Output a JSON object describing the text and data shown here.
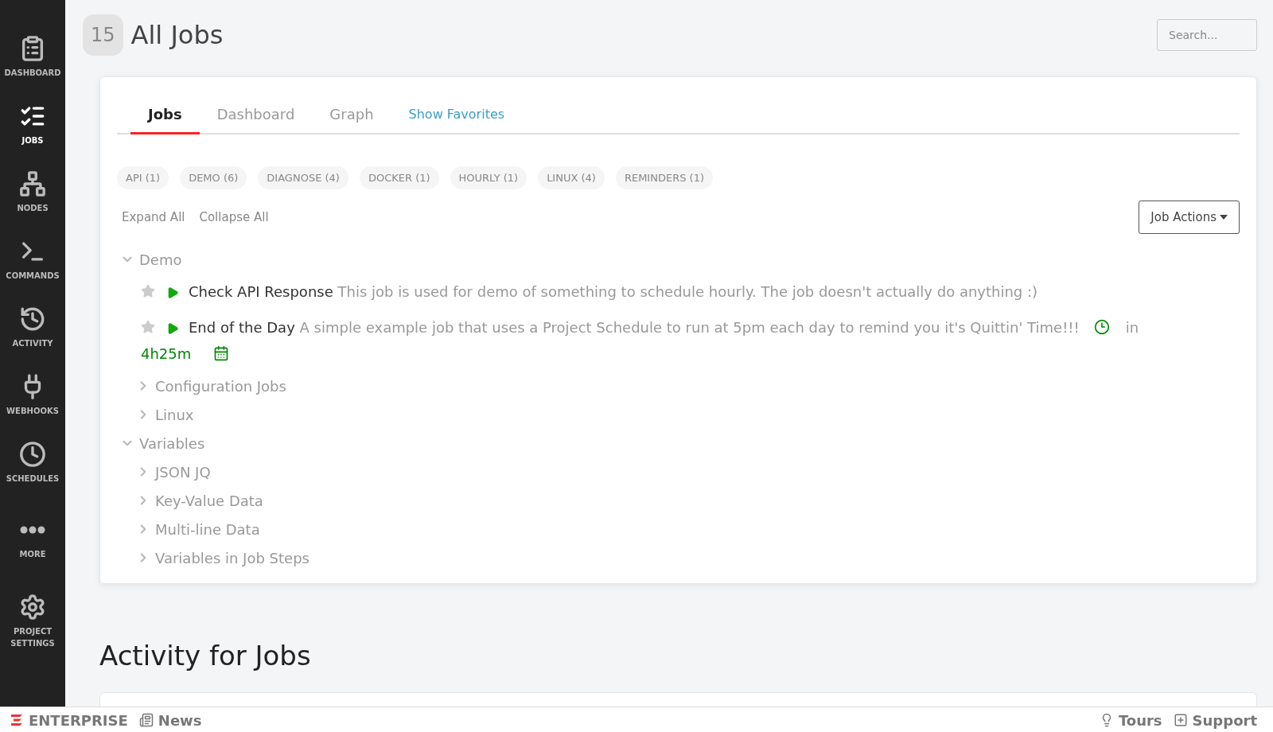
{
  "sidebar": {
    "items": [
      {
        "label": "DASHBOARD",
        "selected": false
      },
      {
        "label": "JOBS",
        "selected": true
      },
      {
        "label": "NODES",
        "selected": false
      },
      {
        "label": "COMMANDS",
        "selected": false
      },
      {
        "label": "ACTIVITY",
        "selected": false
      },
      {
        "label": "WEBHOOKS",
        "selected": false
      },
      {
        "label": "SCHEDULES",
        "selected": false
      },
      {
        "label": "MORE",
        "selected": false
      },
      {
        "label": "PROJECT SETTINGS",
        "selected": false
      }
    ]
  },
  "header": {
    "count": "15",
    "title": "All Jobs",
    "search": {
      "placeholder": "Search..."
    }
  },
  "tabs": [
    {
      "label": "Jobs",
      "selected": true,
      "kind": "tab"
    },
    {
      "label": "Dashboard",
      "selected": false,
      "kind": "tab"
    },
    {
      "label": "Graph",
      "selected": false,
      "kind": "tab"
    },
    {
      "label": "Show Favorites",
      "selected": false,
      "kind": "link"
    }
  ],
  "tags": [
    "API (1)",
    "DEMO (6)",
    "DIAGNOSE (4)",
    "DOCKER (1)",
    "HOURLY (1)",
    "LINUX (4)",
    "REMINDERS (1)"
  ],
  "tree_actions": [
    "Expand All",
    "Collapse All"
  ],
  "job_actions": {
    "label": "Job Actions"
  },
  "tree": [
    {
      "kind": "group",
      "label": "Demo",
      "expanded": true,
      "children": [
        {
          "kind": "job",
          "name": "Check API Response",
          "description": "This job is used for demo of something to schedule hourly. The job doesn't actually do anything :)",
          "favorite": false
        },
        {
          "kind": "job",
          "name": "End of the Day",
          "description": "A simple example job that uses a Project Schedule to run at 5pm each day to remind you it's Quittin' Time!!!",
          "favorite": false,
          "schedule": {
            "prefix": "in",
            "next": "4h25m"
          }
        },
        {
          "kind": "group",
          "label": "Configuration Jobs",
          "expanded": false
        },
        {
          "kind": "group",
          "label": "Linux",
          "expanded": false
        }
      ]
    },
    {
      "kind": "group",
      "label": "Variables",
      "expanded": true,
      "children": [
        {
          "kind": "group",
          "label": "JSON JQ",
          "expanded": false
        },
        {
          "kind": "group",
          "label": "Key-Value Data",
          "expanded": false
        },
        {
          "kind": "group",
          "label": "Multi-line Data",
          "expanded": false
        },
        {
          "kind": "group",
          "label": "Variables in Job Steps",
          "expanded": false
        }
      ]
    }
  ],
  "activity": {
    "title": "Activity for Jobs"
  },
  "footer": {
    "left": [
      "ENTERPRISE",
      "News"
    ],
    "right": [
      "Tours",
      "Support"
    ]
  }
}
